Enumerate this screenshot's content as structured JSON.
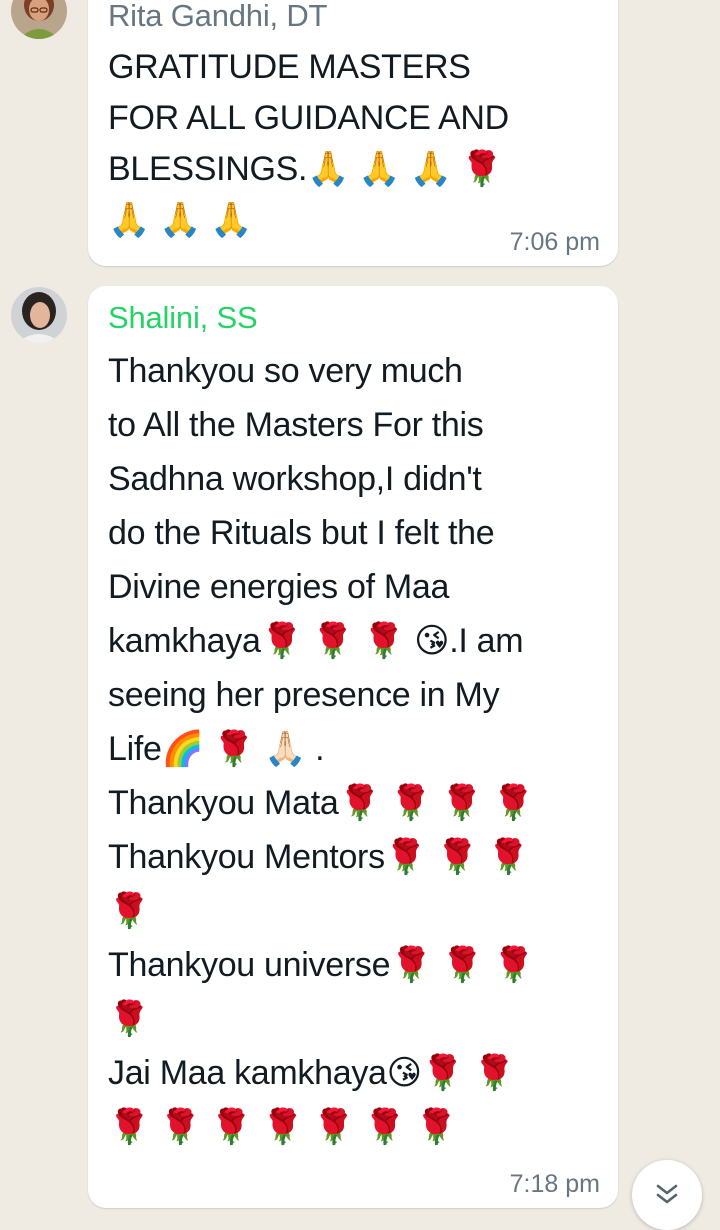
{
  "messages": [
    {
      "sender": "Rita Gandhi, DT",
      "sender_color": "#667781",
      "text": "GRATITUDE MASTERS\nFOR ALL GUIDANCE AND\nBLESSINGS.🙏 🙏 🙏 🌹\n🙏 🙏 🙏",
      "time": "7:06 pm"
    },
    {
      "sender": "Shalini, SS",
      "sender_color": "#25d366",
      "text": "Thankyou so very much\nto All the Masters For this\nSadhna workshop,I didn't\ndo the Rituals but I felt the\nDivine energies of Maa\nkamkhaya🌹 🌹 🌹  😘.I am\nseeing her presence in My\nLife🌈 🌹  🙏🏻 .\nThankyou Mata🌹 🌹 🌹 🌹\nThankyou Mentors🌹 🌹 🌹\n🌹\nThankyou universe🌹 🌹 🌹\n🌹\nJai Maa kamkhaya😘🌹 🌹\n🌹 🌹 🌹 🌹 🌹 🌹 🌹",
      "time": "7:18 pm"
    }
  ],
  "icons": {
    "scroll_down": "double-chevron-down-icon"
  }
}
